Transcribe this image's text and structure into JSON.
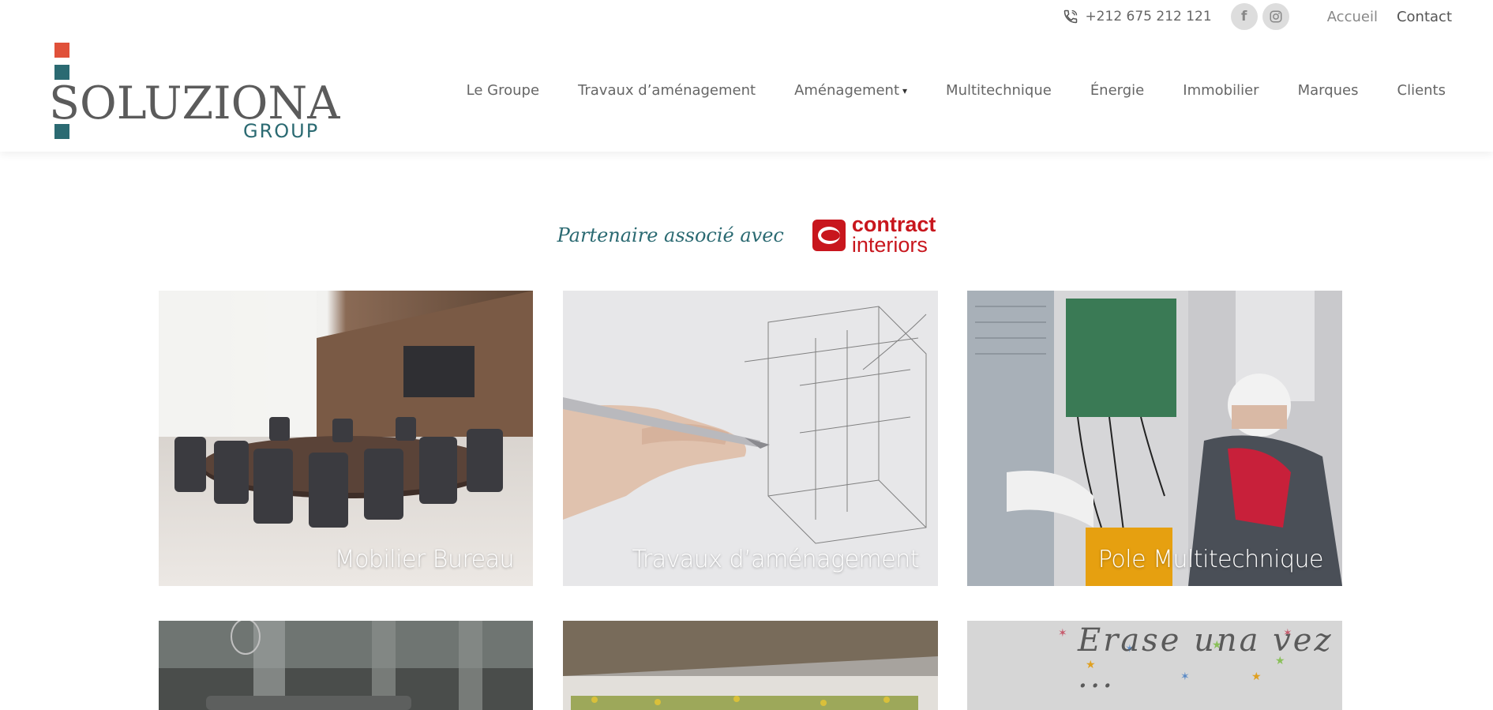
{
  "topbar": {
    "phone": "+212 675 212 121",
    "social": [
      {
        "icon": "facebook-icon",
        "glyph": "f"
      },
      {
        "icon": "instagram-icon",
        "glyph": "◎"
      }
    ],
    "links": [
      "Accueil",
      "Contact"
    ]
  },
  "logo": {
    "word": "SOLUZIONA",
    "group": "GROUP",
    "colors": {
      "orange": "#e0513a",
      "teal": "#2b6a72",
      "gray": "#5b5b5b"
    }
  },
  "nav": {
    "items": [
      {
        "label": "Le Groupe"
      },
      {
        "label": "Travaux d’aménagement"
      },
      {
        "label": "Aménagement",
        "dropdown": true
      },
      {
        "label": "Multitechnique"
      },
      {
        "label": "Énergie"
      },
      {
        "label": "Immobilier"
      },
      {
        "label": "Marques"
      },
      {
        "label": "Clients"
      }
    ]
  },
  "partner": {
    "text": "Partenaire associé avec",
    "brand_line1": "contract",
    "brand_line2": "interiors",
    "brand_color": "#c8161d"
  },
  "cards": [
    {
      "label": "Mobilier Bureau",
      "theme": "office-boardroom"
    },
    {
      "label": "Travaux d’aménagement",
      "theme": "architectural-sketch"
    },
    {
      "label": "Pole Multitechnique",
      "theme": "hvac-technician"
    },
    {
      "label": "",
      "theme": "interior-living"
    },
    {
      "label": "",
      "theme": "garden-terrace"
    },
    {
      "label": "",
      "theme": "Erase una vez ...",
      "overlay_text": "Erase una vez ..."
    }
  ]
}
